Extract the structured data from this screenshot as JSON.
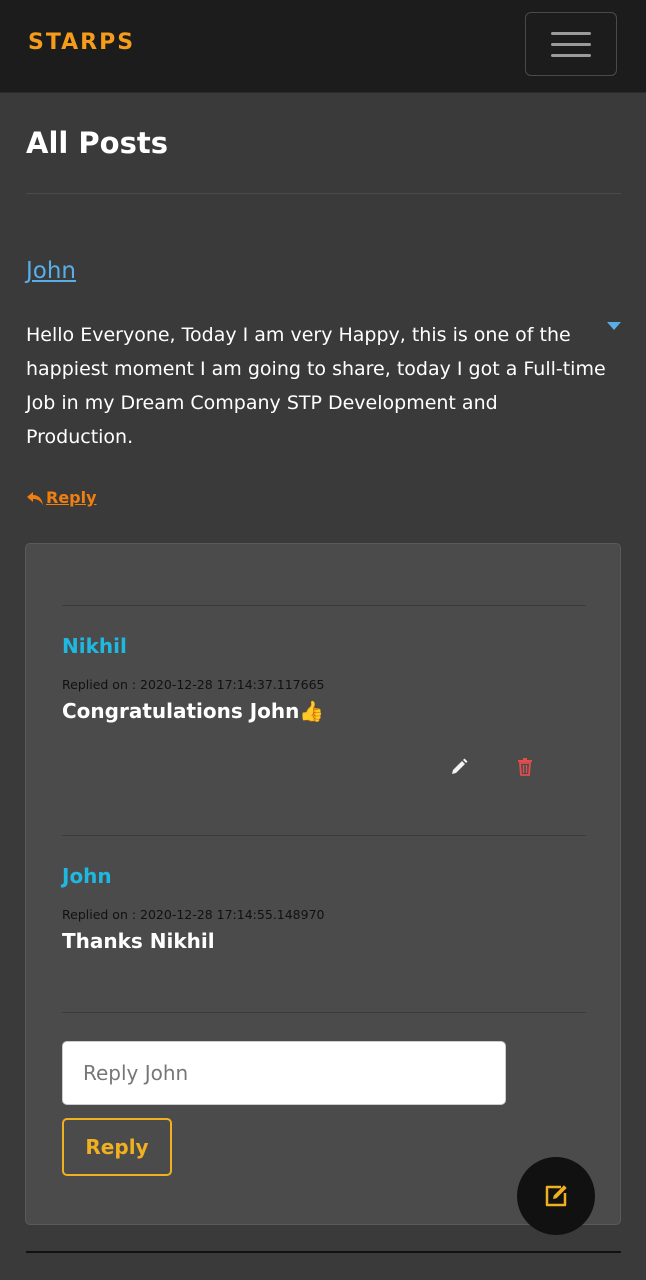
{
  "navbar": {
    "brand": "STARPS"
  },
  "page": {
    "title": "All Posts"
  },
  "post": {
    "author": "John",
    "body": "Hello Everyone, Today I am very Happy, this is one of the happiest moment I am going to share, today I got a Full-time Job in my Dream Company STP Development and Production.",
    "reply_link": "Reply"
  },
  "replies": [
    {
      "name": "Nikhil",
      "meta": "Replied on : 2020-12-28 17:14:37.117665",
      "text": "Congratulations John👍"
    },
    {
      "name": "John",
      "meta": "Replied on : 2020-12-28 17:14:55.148970",
      "text": "Thanks Nikhil"
    }
  ],
  "reply_form": {
    "placeholder": "Reply John",
    "button": "Reply"
  },
  "icons": {
    "menu": "hamburger-menu-icon",
    "caret": "caret-down-icon",
    "reply": "reply-arrow-icon",
    "edit": "pencil-icon",
    "delete": "trash-icon",
    "fab": "edit-square-icon"
  },
  "colors": {
    "brand": "#f59c1a",
    "author_link": "#5aaee8",
    "reply_name": "#1fb8e0",
    "reply_link": "#f07f10",
    "button_outline": "#f0b020",
    "delete": "#e24c4c"
  }
}
